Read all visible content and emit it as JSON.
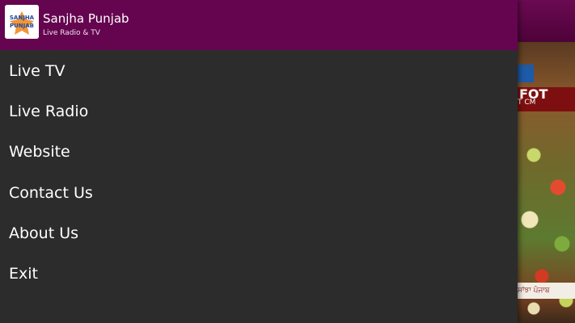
{
  "app": {
    "title": "Sanjha Punjab",
    "subtitle": "Live Radio & TV",
    "logo_text_top": "SANJHA",
    "logo_text_bottom": "PUNJAB"
  },
  "menu": {
    "items": [
      {
        "label": "Live TV"
      },
      {
        "label": "Live Radio"
      },
      {
        "label": "Website"
      },
      {
        "label": "Contact Us"
      },
      {
        "label": "About Us"
      },
      {
        "label": "Exit"
      }
    ]
  },
  "background": {
    "banner_text": "FOT",
    "banner_sub": "T CM",
    "footer_text": "ਸਾਂਝਾ ਪੰਜਾਬ"
  },
  "colors": {
    "header": "#650550",
    "drawer": "#2c2c2c",
    "text": "#ffffff"
  }
}
